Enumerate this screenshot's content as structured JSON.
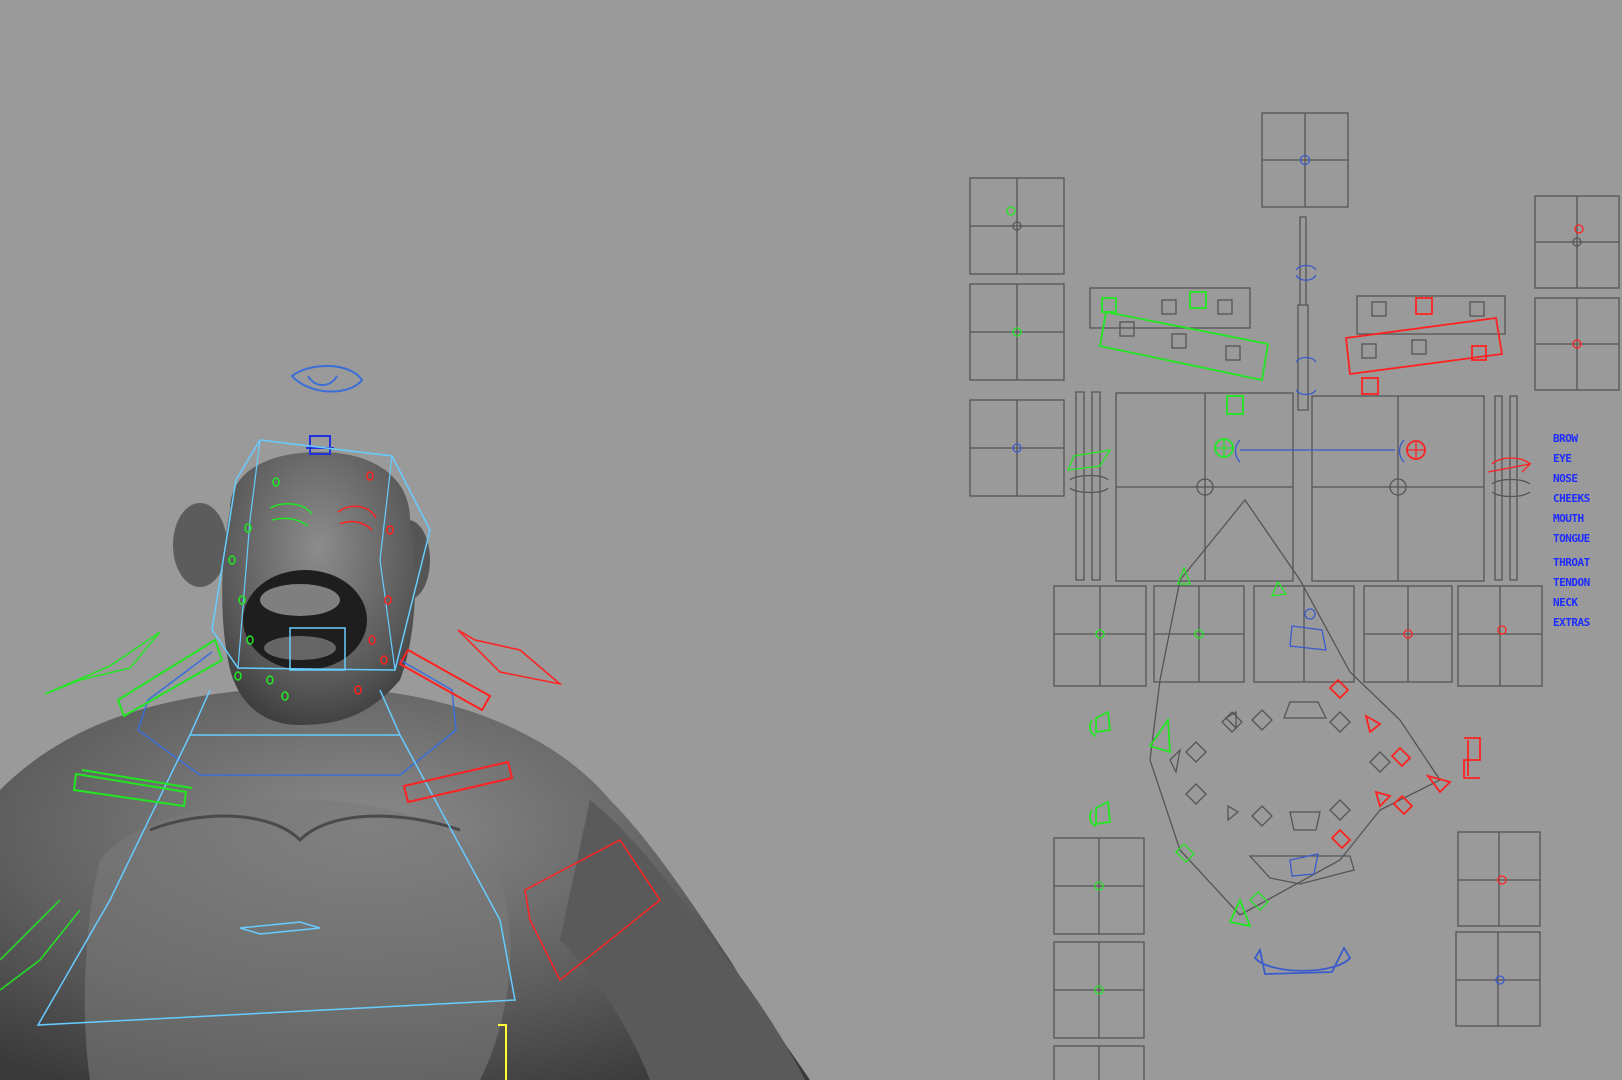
{
  "viewport": {
    "background_color": "#9a9a9a",
    "mesh_color": "#6b6b6b",
    "colors": {
      "left_side": "#22e622",
      "right_side": "#ff2222",
      "center": "#2244ff",
      "cage": "#66ccff",
      "panel_lines": "#5a5a5a"
    }
  },
  "picker": {
    "section_labels": [
      "BROW",
      "EYE",
      "NOSE",
      "CHEEKS",
      "MOUTH",
      "TONGUE",
      "THROAT",
      "TENDON",
      "NECK",
      "EXTRAS"
    ]
  }
}
